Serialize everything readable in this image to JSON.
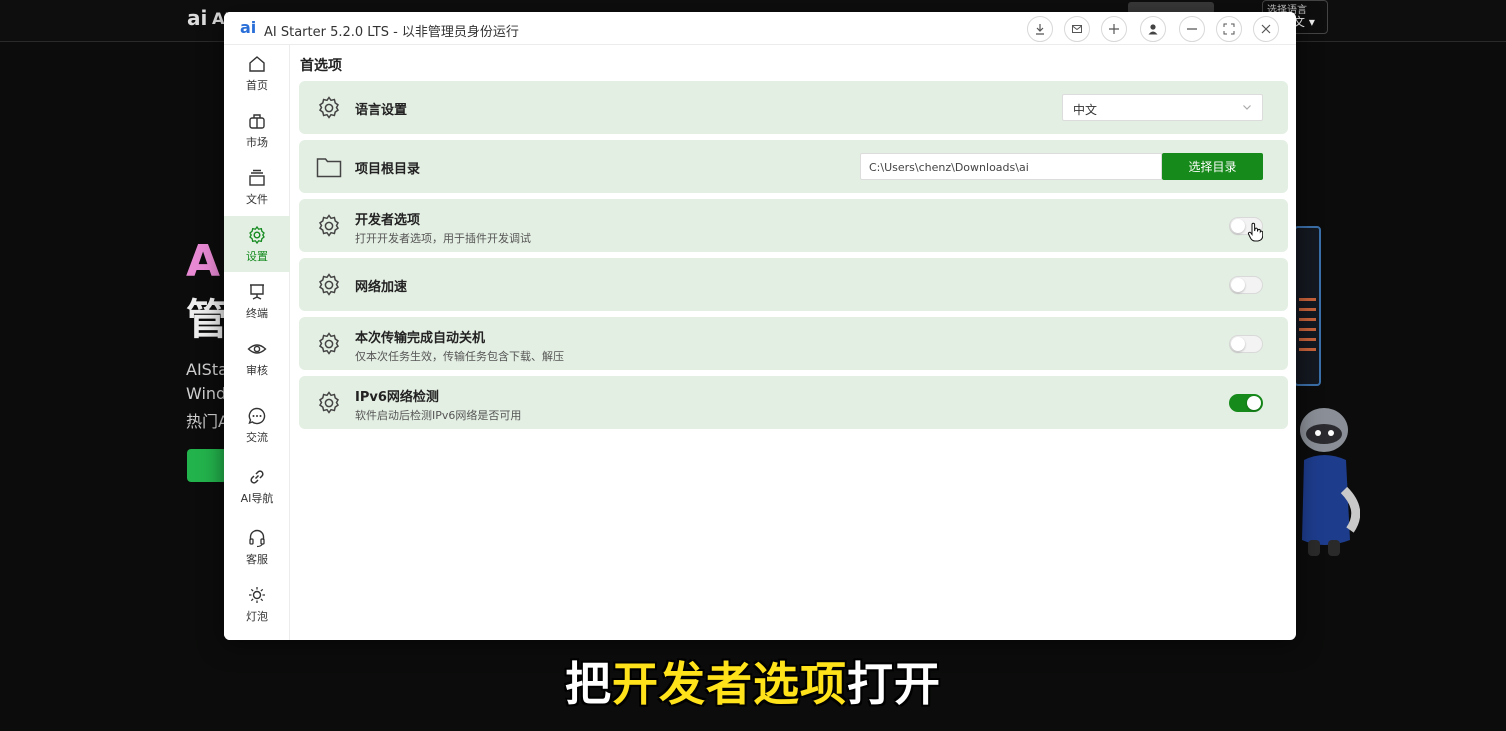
{
  "background_site": {
    "logo": "ai",
    "logo_text": "AI",
    "language_label": "选择语言",
    "language_current": "文",
    "hero_line1": "A",
    "hero_line2": "管",
    "hero_lines": [
      "AISta",
      "Wind",
      "热门A"
    ]
  },
  "window": {
    "logo": "ai",
    "title": "AI Starter 5.2.0 LTS - 以非管理员身份运行",
    "titlebar_buttons": [
      "download-icon",
      "mail-icon",
      "plus-icon",
      "user-icon",
      "minimize-icon",
      "fullscreen-icon",
      "close-icon"
    ]
  },
  "sidebar": {
    "items": [
      {
        "label": "首页",
        "icon": "home-icon"
      },
      {
        "label": "市场",
        "icon": "market-icon"
      },
      {
        "label": "文件",
        "icon": "files-icon"
      },
      {
        "label": "设置",
        "icon": "gear-icon",
        "active": true
      },
      {
        "label": "终端",
        "icon": "terminal-icon"
      },
      {
        "label": "审核",
        "icon": "eye-icon"
      },
      {
        "label": "交流",
        "icon": "chat-icon"
      },
      {
        "label": "AI导航",
        "icon": "link-icon"
      },
      {
        "label": "客服",
        "icon": "headset-icon"
      },
      {
        "label": "灯泡",
        "icon": "bulb-icon"
      }
    ]
  },
  "content": {
    "page_title": "首选项",
    "language": {
      "title": "语言设置",
      "value": "中文"
    },
    "project_root": {
      "title": "项目根目录",
      "path": "C:\\Users\\chenz\\Downloads\\ai",
      "button": "选择目录"
    },
    "developer": {
      "title": "开发者选项",
      "subtitle": "打开开发者选项，用于插件开发调试",
      "enabled": false
    },
    "network_accel": {
      "title": "网络加速",
      "enabled": false
    },
    "auto_shutdown": {
      "title": "本次传输完成自动关机",
      "subtitle": "仅本次任务生效，传输任务包含下载、解压",
      "enabled": false
    },
    "ipv6": {
      "title": "IPv6网络检测",
      "subtitle": "软件启动后检测IPv6网络是否可用",
      "enabled": true
    }
  },
  "caption": {
    "before": "把",
    "highlight": "开发者选项",
    "after": "打开"
  },
  "colors": {
    "accent": "#168a1a",
    "row_bg": "#e4efe3",
    "caption_highlight": "#ffe21a"
  }
}
